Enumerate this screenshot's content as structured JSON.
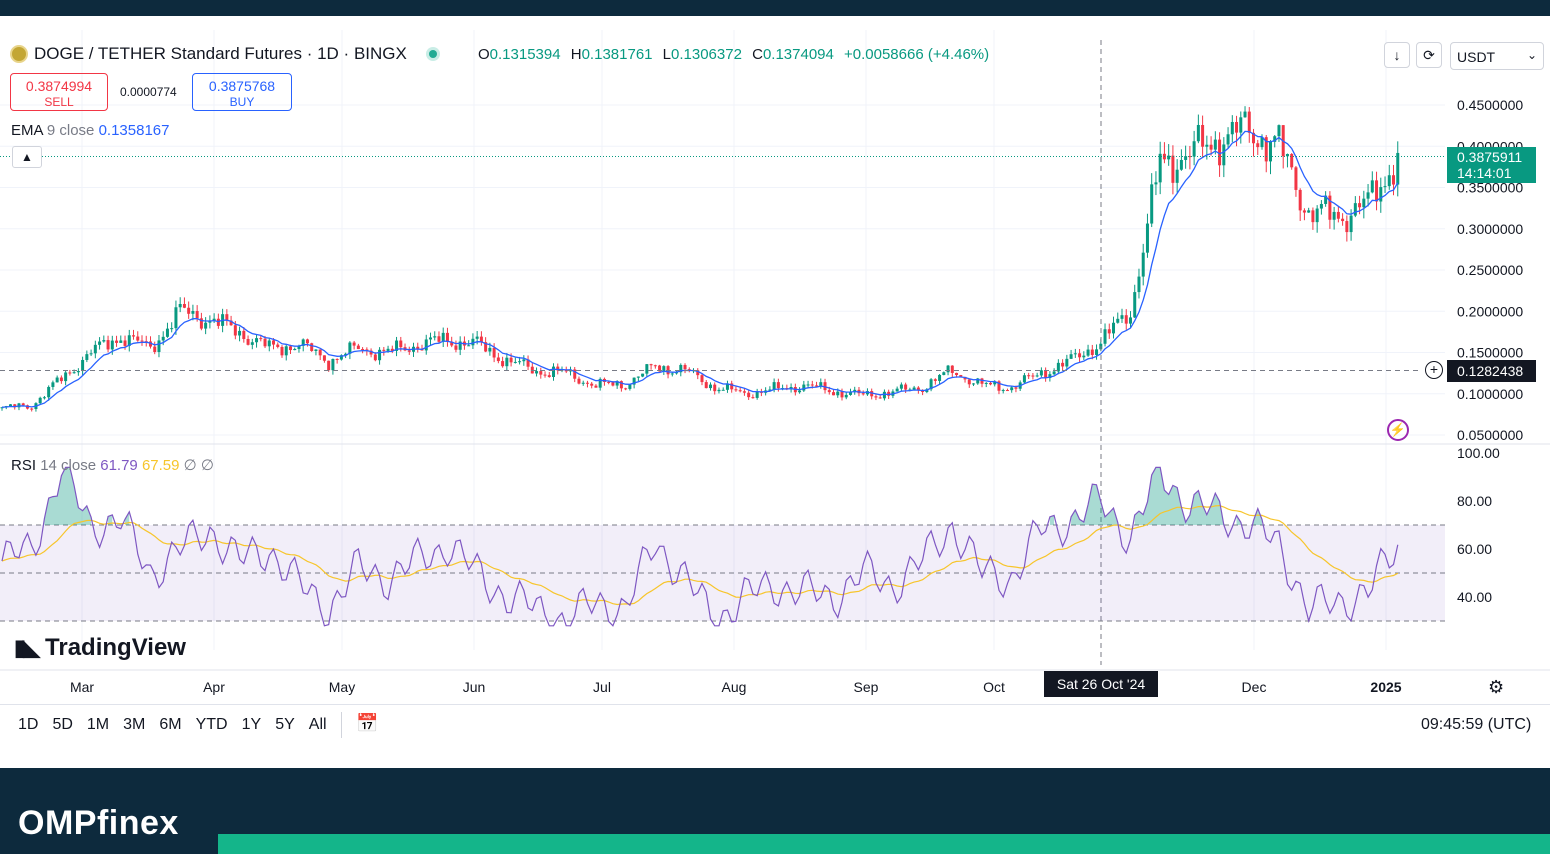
{
  "header": {
    "symbol_title": "DOGE / TETHER Standard Futures · 1D · BINGX",
    "ohlc": [
      {
        "k": "O",
        "v": "0.1315394"
      },
      {
        "k": "H",
        "v": "0.1381761"
      },
      {
        "k": "L",
        "v": "0.1306372"
      },
      {
        "k": "C",
        "v": "0.1374094"
      }
    ],
    "change": "+0.0058666 (+4.46%)",
    "currency": "USDT"
  },
  "trade": {
    "sell_price": "0.3874994",
    "sell_label": "SELL",
    "spread": "0.0000774",
    "buy_price": "0.3875768",
    "buy_label": "BUY"
  },
  "ema": {
    "label": "EMA",
    "params": "9 close",
    "value": "0.1358167"
  },
  "rsi": {
    "label": "RSI",
    "params": "14 close",
    "value": "61.79",
    "ma_value": "67.59",
    "flags": "∅ ∅"
  },
  "last_price": {
    "price": "0.3875911",
    "countdown": "14:14:01"
  },
  "crosshair": {
    "price": "0.1282438",
    "date": "Sat 26 Oct '24"
  },
  "timeframes": [
    "1D",
    "5D",
    "1M",
    "3M",
    "6M",
    "YTD",
    "1Y",
    "5Y",
    "All"
  ],
  "clock": "09:45:59 (UTC)",
  "watermark": "TradingView",
  "footer_brand": "OMPfinex",
  "colors": {
    "up": "#089981",
    "down": "#f23645",
    "ema": "#2962ff",
    "rsi": "#7e57c2",
    "rsi_ma": "#f7c52b",
    "footer": "#0d2a3d",
    "footer_accent": "#14b58a"
  },
  "chart_data": {
    "type": "candlestick",
    "title": "DOGE / TETHER Standard Futures · 1D · BINGX",
    "price_axis": {
      "range": [
        0.05,
        0.45
      ],
      "ticks": [
        "0.4500000",
        "0.4000000",
        "0.3500000",
        "0.3000000",
        "0.2500000",
        "0.2000000",
        "0.1500000",
        "0.1000000",
        "0.0500000"
      ]
    },
    "time_axis": {
      "ticks": [
        "Mar",
        "Apr",
        "May",
        "Jun",
        "Jul",
        "Aug",
        "Sep",
        "Oct",
        "Dec",
        "2025"
      ]
    },
    "close_series": {
      "name": "DOGE close (approx.)",
      "x": [
        "2024-02-12",
        "2024-02-19",
        "2024-02-26",
        "2024-03-04",
        "2024-03-11",
        "2024-03-18",
        "2024-03-25",
        "2024-04-01",
        "2024-04-08",
        "2024-04-15",
        "2024-04-22",
        "2024-04-29",
        "2024-05-06",
        "2024-05-13",
        "2024-05-20",
        "2024-05-27",
        "2024-06-03",
        "2024-06-10",
        "2024-06-17",
        "2024-06-24",
        "2024-07-01",
        "2024-07-08",
        "2024-07-15",
        "2024-07-22",
        "2024-07-29",
        "2024-08-05",
        "2024-08-12",
        "2024-08-19",
        "2024-08-26",
        "2024-09-02",
        "2024-09-09",
        "2024-09-16",
        "2024-09-23",
        "2024-09-30",
        "2024-10-07",
        "2024-10-14",
        "2024-10-21",
        "2024-10-28",
        "2024-11-04",
        "2024-11-11",
        "2024-11-18",
        "2024-11-25",
        "2024-12-02",
        "2024-12-09",
        "2024-12-16",
        "2024-12-23",
        "2024-12-30",
        "2025-01-03"
      ],
      "values": [
        0.082,
        0.086,
        0.118,
        0.15,
        0.17,
        0.155,
        0.2,
        0.19,
        0.175,
        0.155,
        0.16,
        0.14,
        0.155,
        0.15,
        0.16,
        0.165,
        0.16,
        0.14,
        0.128,
        0.125,
        0.11,
        0.112,
        0.133,
        0.128,
        0.108,
        0.1,
        0.105,
        0.11,
        0.103,
        0.098,
        0.102,
        0.108,
        0.128,
        0.11,
        0.108,
        0.125,
        0.14,
        0.163,
        0.2,
        0.38,
        0.39,
        0.41,
        0.42,
        0.4,
        0.32,
        0.315,
        0.33,
        0.3875
      ]
    },
    "ema": {
      "name": "EMA 9 close",
      "last": 0.1358167
    },
    "rsi": {
      "name": "RSI 14 close",
      "range": [
        20,
        100
      ],
      "ticks": [
        "100.00",
        "80.00",
        "60.00",
        "40.00"
      ],
      "band": [
        30,
        70
      ],
      "values": [
        55,
        60,
        93,
        70,
        72,
        50,
        60,
        68,
        55,
        60,
        45,
        35,
        52,
        48,
        55,
        62,
        50,
        40,
        35,
        30,
        38,
        35,
        63,
        48,
        30,
        40,
        45,
        42,
        40,
        50,
        45,
        55,
        70,
        50,
        48,
        68,
        72,
        80,
        65,
        92,
        78,
        75,
        70,
        62,
        35,
        38,
        42,
        61.79
      ],
      "ma_last": 67.59
    }
  }
}
